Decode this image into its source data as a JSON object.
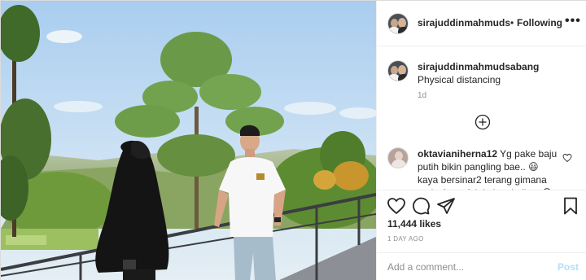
{
  "header": {
    "username": "sirajuddinmahmudsabang",
    "separator": "•",
    "follow_label": "Following",
    "more_label": "•••",
    "avatar_icon": "user-avatar"
  },
  "caption": {
    "username": "sirajuddinmahmudsabang",
    "text": "Physical distancing",
    "time": "1d"
  },
  "load_more_icon": "plus-circle-icon",
  "comments": [
    {
      "username": "oktavianiherna12",
      "text": "Yg pake baju putih bikin pangling bae.. 😃 kaya bersinar2 terang gimana gtuh. Apa efek kalem kali ya 😊",
      "like_icon": "heart-outline-icon"
    }
  ],
  "actions": {
    "icons": [
      "heart-outline-icon",
      "comment-icon",
      "share-icon",
      "bookmark-icon"
    ]
  },
  "likes": "11,444 likes",
  "date": "1 DAY AGO",
  "add_comment": {
    "placeholder": "Add a comment...",
    "post_label": "Post"
  },
  "colors": {
    "text": "#262626",
    "secondary": "#8e8e8e",
    "border": "#efefef",
    "post_disabled": "#b2dffc",
    "sky": "#b7d7f2"
  }
}
